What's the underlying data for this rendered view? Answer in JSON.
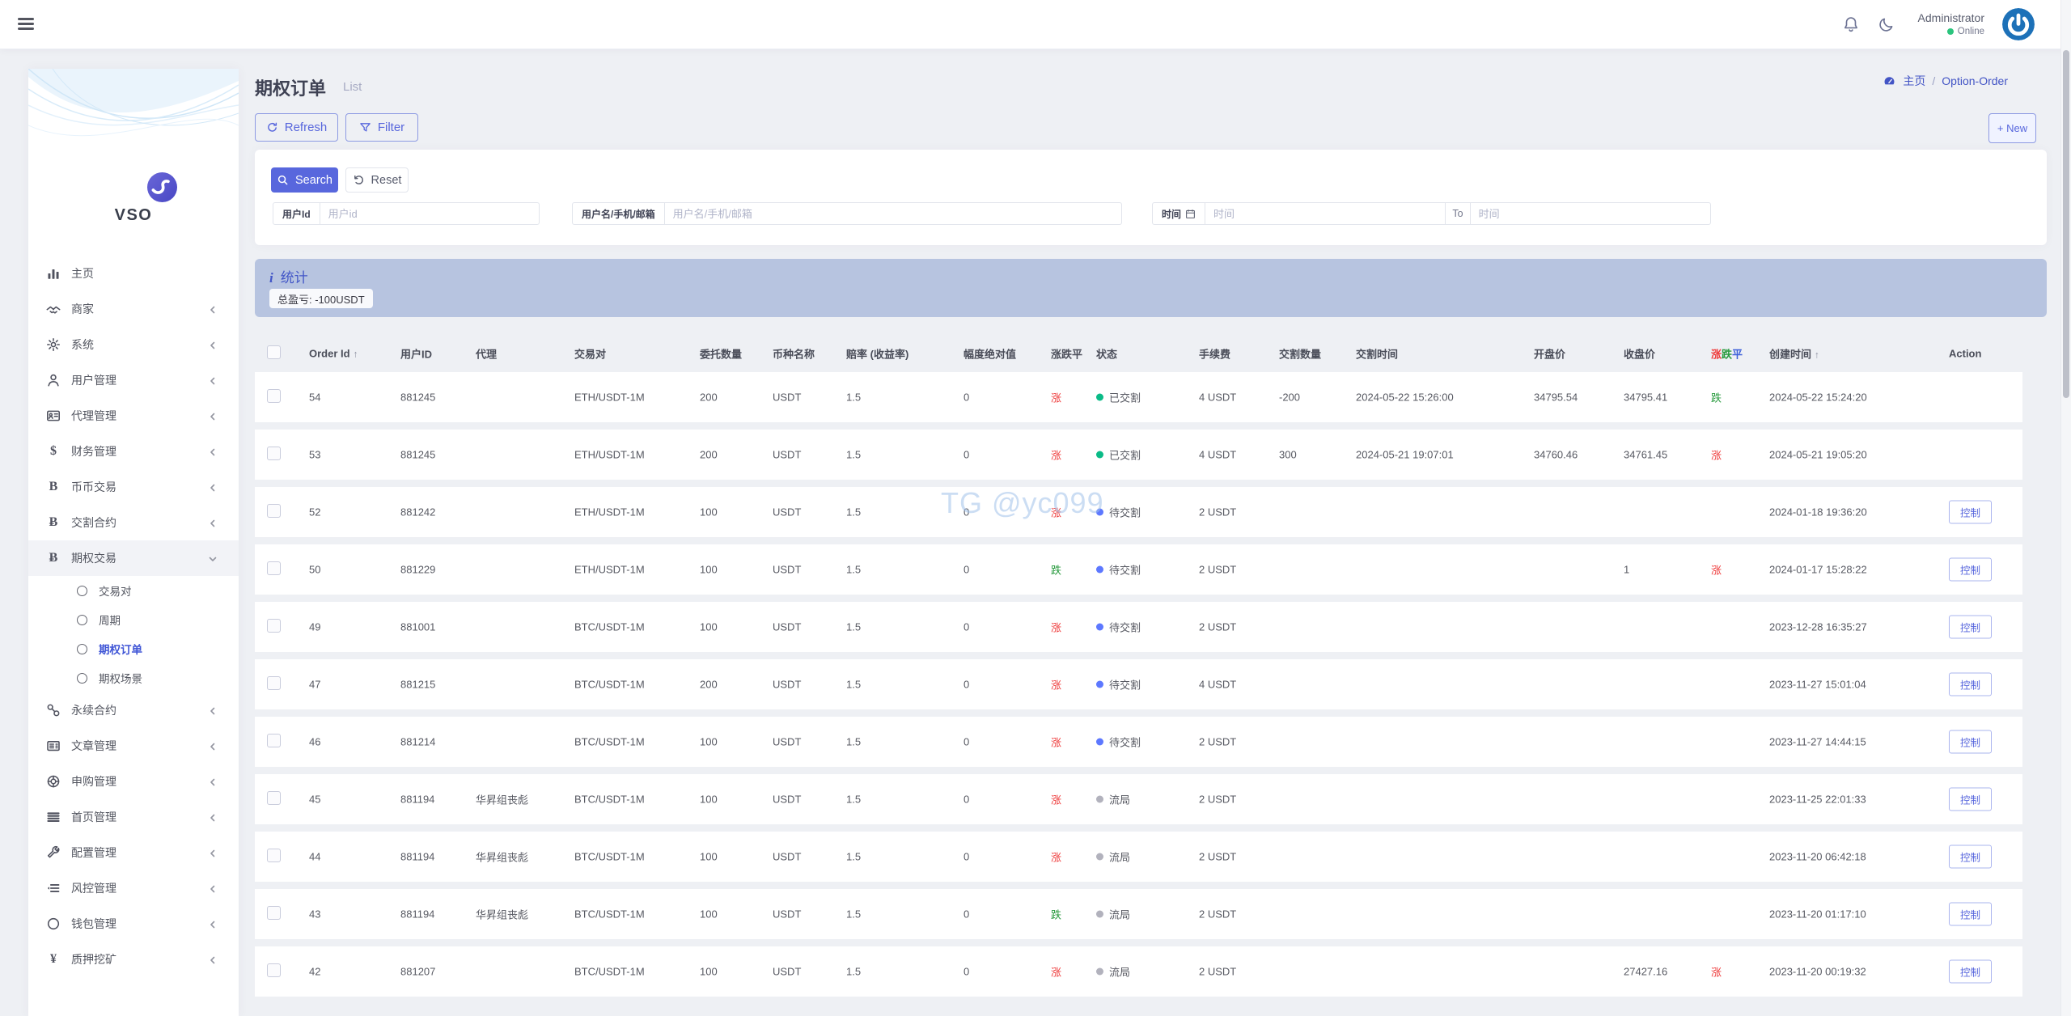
{
  "topbar": {
    "user_name": "Administrator",
    "user_status": "Online"
  },
  "sidebar": {
    "logo_text": "VSO",
    "items": [
      {
        "label": "主页",
        "icon": "chart-bars",
        "chevron": false
      },
      {
        "label": "商家",
        "icon": "merchant",
        "chevron": true
      },
      {
        "label": "系统",
        "icon": "gear",
        "chevron": true
      },
      {
        "label": "用户管理",
        "icon": "user",
        "chevron": true
      },
      {
        "label": "代理管理",
        "icon": "id-card",
        "chevron": true
      },
      {
        "label": "财务管理",
        "icon": "dollar",
        "chevron": true
      },
      {
        "label": "币币交易",
        "icon": "letter-b",
        "chevron": true
      },
      {
        "label": "交割合约",
        "icon": "bitcoin",
        "chevron": true
      },
      {
        "label": "期权交易",
        "icon": "bitcoin",
        "chevron": "down",
        "expanded": true,
        "children": [
          {
            "label": "交易对",
            "active": false
          },
          {
            "label": "周期",
            "active": false
          },
          {
            "label": "期权订单",
            "active": true
          },
          {
            "label": "期权场景",
            "active": false
          }
        ]
      },
      {
        "label": "永续合约",
        "icon": "chain",
        "chevron": true
      },
      {
        "label": "文章管理",
        "icon": "newspaper",
        "chevron": true
      },
      {
        "label": "申购管理",
        "icon": "lifebuoy",
        "chevron": true
      },
      {
        "label": "首页管理",
        "icon": "menu-lines",
        "chevron": true
      },
      {
        "label": "配置管理",
        "icon": "wrench",
        "chevron": true
      },
      {
        "label": "风控管理",
        "icon": "list-indent",
        "chevron": true
      },
      {
        "label": "钱包管理",
        "icon": "circle",
        "chevron": true
      },
      {
        "label": "质押挖矿",
        "icon": "yen",
        "chevron": true
      }
    ]
  },
  "page": {
    "title": "期权订单",
    "subtitle": "List",
    "breadcrumb": {
      "home": "主页",
      "separator": "/",
      "current": "Option-Order"
    },
    "toolbar": {
      "refresh": "Refresh",
      "filter": "Filter",
      "new_label": "+ New"
    },
    "search": {
      "submit": "Search",
      "reset": "Reset",
      "field_uid": {
        "label": "用户Id",
        "placeholder": "用户id"
      },
      "field_uname": {
        "label": "用户名/手机/邮箱",
        "placeholder": "用户名/手机/邮箱"
      },
      "field_time": {
        "label": "时间",
        "placeholder_from": "时间",
        "to": "To",
        "placeholder_to": "时间"
      }
    },
    "stats": {
      "title": "统计",
      "summary": "总盈亏: -100USDT"
    }
  },
  "table": {
    "headers": [
      {
        "label": "Order Id",
        "sort": "↑"
      },
      {
        "label": "用户ID"
      },
      {
        "label": "代理"
      },
      {
        "label": "交易对"
      },
      {
        "label": "委托数量"
      },
      {
        "label": "币种名称"
      },
      {
        "label": "赔率 (收益率)"
      },
      {
        "label": "幅度绝对值"
      },
      {
        "label": "涨跌平"
      },
      {
        "label": "状态"
      },
      {
        "label": "手续费"
      },
      {
        "label": "交割数量"
      },
      {
        "label": "交割时间"
      },
      {
        "label": "开盘价"
      },
      {
        "label": "收盘价"
      },
      {
        "label": "涨跌平",
        "colored": true
      },
      {
        "label": "创建时间",
        "sort": "↑"
      },
      {
        "label": "Action"
      }
    ],
    "action_label": "控制",
    "rows": [
      {
        "id": "54",
        "uid": "881245",
        "agent": "",
        "pair": "ETH/USDT-1M",
        "amount": "200",
        "coin": "USDT",
        "odds": "1.5",
        "amplitude": "0",
        "direction": "涨",
        "direction_key": "rise",
        "status": "已交割",
        "status_key": "settled",
        "fee": "4 USDT",
        "settle_amount": "-200",
        "settle_time": "2024-05-22 15:26:00",
        "open": "34795.54",
        "close": "34795.41",
        "result": "跌",
        "result_key": "fall",
        "created": "2024-05-22 15:24:20",
        "has_action": false
      },
      {
        "id": "53",
        "uid": "881245",
        "agent": "",
        "pair": "ETH/USDT-1M",
        "amount": "200",
        "coin": "USDT",
        "odds": "1.5",
        "amplitude": "0",
        "direction": "涨",
        "direction_key": "rise",
        "status": "已交割",
        "status_key": "settled",
        "fee": "4 USDT",
        "settle_amount": "300",
        "settle_time": "2024-05-21 19:07:01",
        "open": "34760.46",
        "close": "34761.45",
        "result": "涨",
        "result_key": "rise",
        "created": "2024-05-21 19:05:20",
        "has_action": false
      },
      {
        "id": "52",
        "uid": "881242",
        "agent": "",
        "pair": "ETH/USDT-1M",
        "amount": "100",
        "coin": "USDT",
        "odds": "1.5",
        "amplitude": "0",
        "direction": "涨",
        "direction_key": "rise",
        "status": "待交割",
        "status_key": "pending",
        "fee": "2 USDT",
        "settle_amount": "",
        "settle_time": "",
        "open": "",
        "close": "",
        "result": "",
        "result_key": "",
        "created": "2024-01-18 19:36:20",
        "has_action": true
      },
      {
        "id": "50",
        "uid": "881229",
        "agent": "",
        "pair": "ETH/USDT-1M",
        "amount": "100",
        "coin": "USDT",
        "odds": "1.5",
        "amplitude": "0",
        "direction": "跌",
        "direction_key": "fall",
        "status": "待交割",
        "status_key": "pending",
        "fee": "2 USDT",
        "settle_amount": "",
        "settle_time": "",
        "open": "",
        "close": "1",
        "result": "涨",
        "result_key": "rise",
        "created": "2024-01-17 15:28:22",
        "has_action": true
      },
      {
        "id": "49",
        "uid": "881001",
        "agent": "",
        "pair": "BTC/USDT-1M",
        "amount": "100",
        "coin": "USDT",
        "odds": "1.5",
        "amplitude": "0",
        "direction": "涨",
        "direction_key": "rise",
        "status": "待交割",
        "status_key": "pending",
        "fee": "2 USDT",
        "settle_amount": "",
        "settle_time": "",
        "open": "",
        "close": "",
        "result": "",
        "result_key": "",
        "created": "2023-12-28 16:35:27",
        "has_action": true
      },
      {
        "id": "47",
        "uid": "881215",
        "agent": "",
        "pair": "BTC/USDT-1M",
        "amount": "200",
        "coin": "USDT",
        "odds": "1.5",
        "amplitude": "0",
        "direction": "涨",
        "direction_key": "rise",
        "status": "待交割",
        "status_key": "pending",
        "fee": "4 USDT",
        "settle_amount": "",
        "settle_time": "",
        "open": "",
        "close": "",
        "result": "",
        "result_key": "",
        "created": "2023-11-27 15:01:04",
        "has_action": true
      },
      {
        "id": "46",
        "uid": "881214",
        "agent": "",
        "pair": "BTC/USDT-1M",
        "amount": "100",
        "coin": "USDT",
        "odds": "1.5",
        "amplitude": "0",
        "direction": "涨",
        "direction_key": "rise",
        "status": "待交割",
        "status_key": "pending",
        "fee": "2 USDT",
        "settle_amount": "",
        "settle_time": "",
        "open": "",
        "close": "",
        "result": "",
        "result_key": "",
        "created": "2023-11-27 14:44:15",
        "has_action": true
      },
      {
        "id": "45",
        "uid": "881194",
        "agent": "华昇组丧彪",
        "pair": "BTC/USDT-1M",
        "amount": "100",
        "coin": "USDT",
        "odds": "1.5",
        "amplitude": "0",
        "direction": "涨",
        "direction_key": "rise",
        "status": "流局",
        "status_key": "void",
        "fee": "2 USDT",
        "settle_amount": "",
        "settle_time": "",
        "open": "",
        "close": "",
        "result": "",
        "result_key": "",
        "created": "2023-11-25 22:01:33",
        "has_action": true
      },
      {
        "id": "44",
        "uid": "881194",
        "agent": "华昇组丧彪",
        "pair": "BTC/USDT-1M",
        "amount": "100",
        "coin": "USDT",
        "odds": "1.5",
        "amplitude": "0",
        "direction": "涨",
        "direction_key": "rise",
        "status": "流局",
        "status_key": "void",
        "fee": "2 USDT",
        "settle_amount": "",
        "settle_time": "",
        "open": "",
        "close": "",
        "result": "",
        "result_key": "",
        "created": "2023-11-20 06:42:18",
        "has_action": true
      },
      {
        "id": "43",
        "uid": "881194",
        "agent": "华昇组丧彪",
        "pair": "BTC/USDT-1M",
        "amount": "100",
        "coin": "USDT",
        "odds": "1.5",
        "amplitude": "0",
        "direction": "跌",
        "direction_key": "fall",
        "status": "流局",
        "status_key": "void",
        "fee": "2 USDT",
        "settle_amount": "",
        "settle_time": "",
        "open": "",
        "close": "",
        "result": "",
        "result_key": "",
        "created": "2023-11-20 01:17:10",
        "has_action": true
      },
      {
        "id": "42",
        "uid": "881207",
        "agent": "",
        "pair": "BTC/USDT-1M",
        "amount": "100",
        "coin": "USDT",
        "odds": "1.5",
        "amplitude": "0",
        "direction": "涨",
        "direction_key": "rise",
        "status": "流局",
        "status_key": "void",
        "fee": "2 USDT",
        "settle_amount": "",
        "settle_time": "",
        "open": "",
        "close": "27427.16",
        "result": "涨",
        "result_key": "rise",
        "created": "2023-11-20 00:19:32",
        "has_action": true
      }
    ]
  },
  "watermark": {
    "text": "TG @yc099"
  },
  "colors": {
    "accent": "#5867dd",
    "rise": "#ee3b3b",
    "fall": "#279a3d",
    "flat": "#3b5fd9",
    "status_settled": "#0abb87",
    "status_pending": "#5d78ff",
    "status_void": "#b2b2bd",
    "banner_bg": "#b7c4e0",
    "banner_text": "#4256c7",
    "avatar_bg": "#1d71b8",
    "online": "#2bc47d"
  }
}
